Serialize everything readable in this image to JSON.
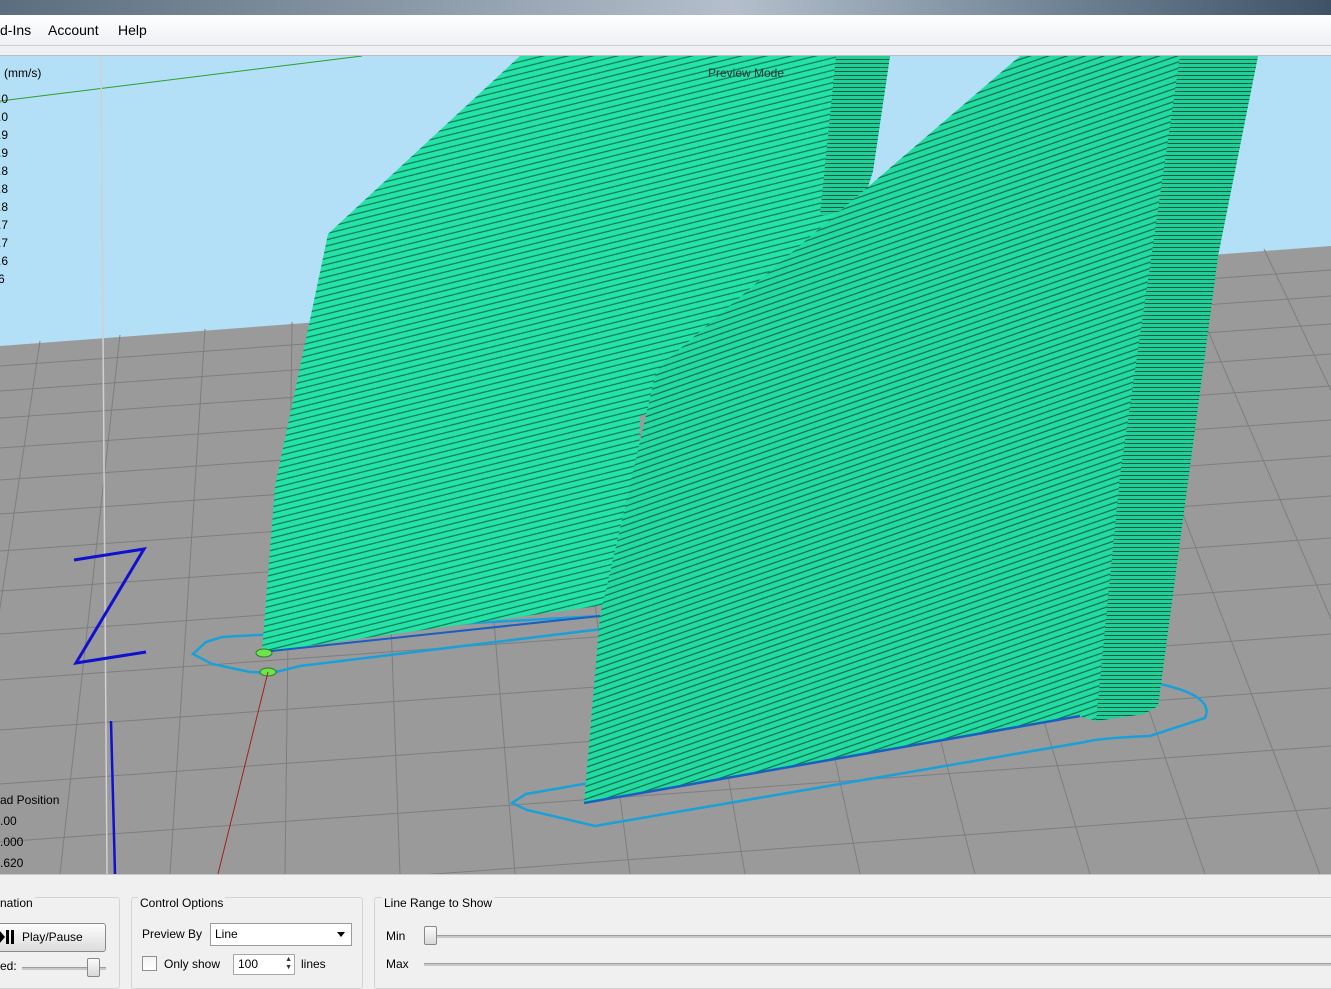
{
  "menu": {
    "items": [
      {
        "label": "d-Ins"
      },
      {
        "label": "Account"
      },
      {
        "label": "Help"
      }
    ]
  },
  "viewport": {
    "speed_header": "(mm/s)",
    "speed_values": [
      ".0",
      ".0",
      ".9",
      ".9",
      ".8",
      ".8",
      ".8",
      ".7",
      ".7",
      ".6",
      "6"
    ],
    "preview_mode": "Preview Mode",
    "axis_label": "Z",
    "head_position": {
      "title": "ad Position",
      "values": [
        ".00",
        ".000",
        ".620"
      ]
    },
    "colors": {
      "sky": "#b3e0f7",
      "bed": "#9a9a9a",
      "grid": "#7e7e7e",
      "print": "#23e3a6",
      "outline": "#1aa0d8",
      "axis_blue": "#1010d0"
    }
  },
  "bottom": {
    "animation": {
      "title": "nation",
      "play_pause_label": "Play/Pause",
      "speed_label": "ed:",
      "speed_level_fraction": 0.85
    },
    "control_options": {
      "title": "Control Options",
      "preview_by_label": "Preview By",
      "preview_by_value": "Line",
      "only_show_label": "Only show",
      "only_show_value": "100",
      "lines_label": "lines"
    },
    "line_range": {
      "title": "Line Range to Show",
      "min_label": "Min",
      "max_label": "Max",
      "min_fraction": 0.0
    }
  }
}
